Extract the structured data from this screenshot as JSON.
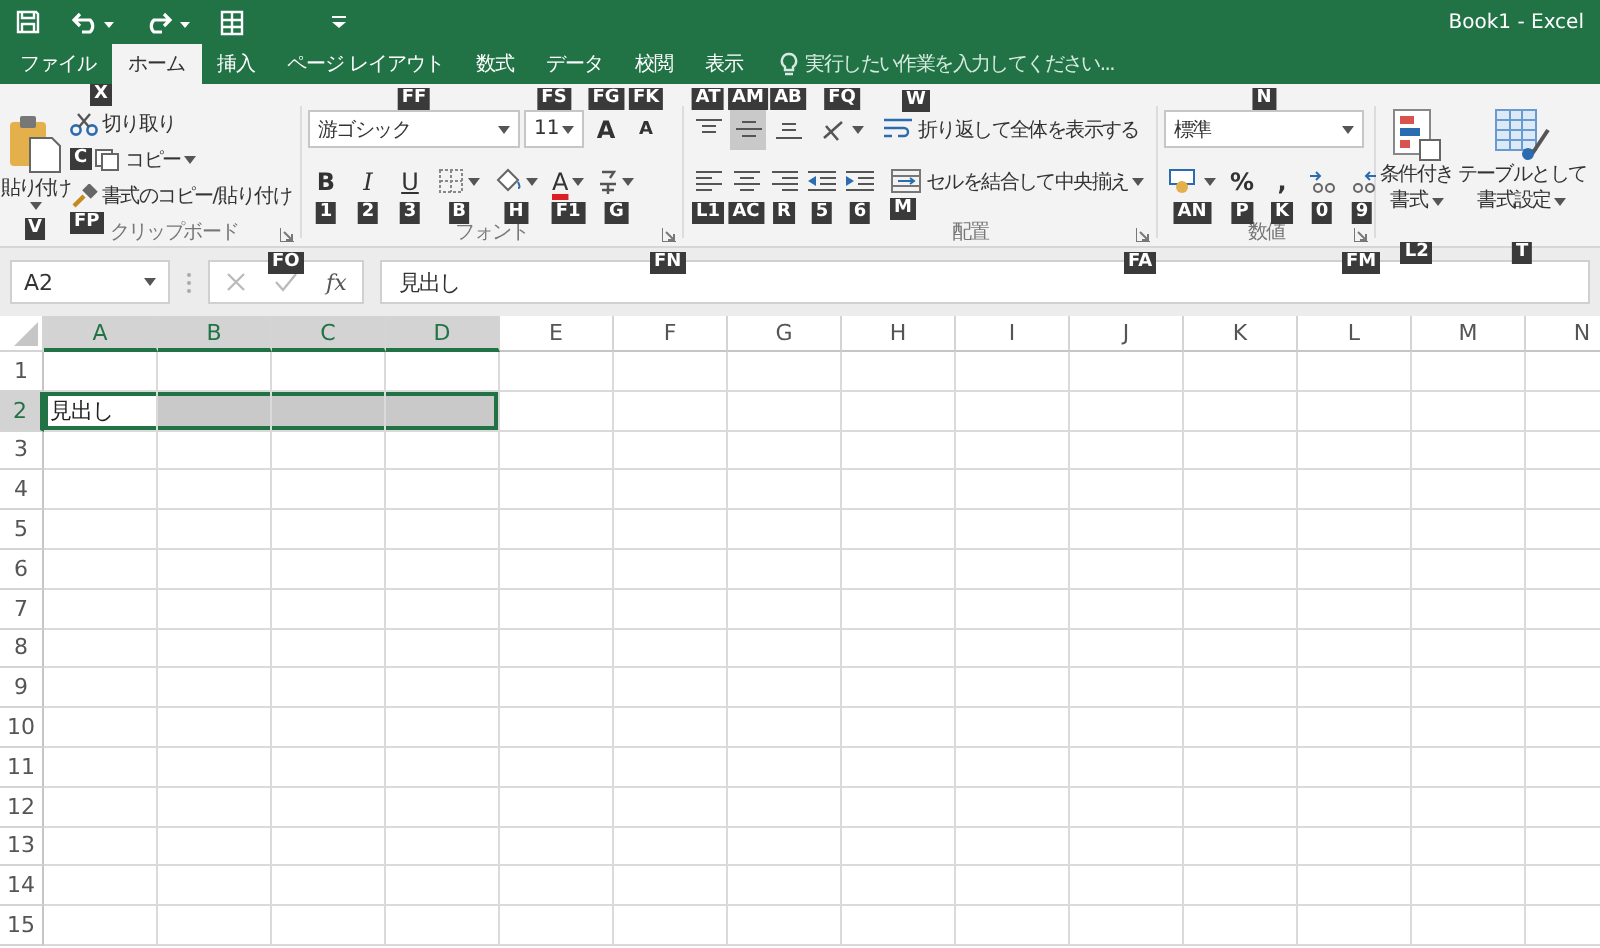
{
  "window": {
    "title": "Book1 - Excel"
  },
  "tabs": [
    {
      "label": "ファイル",
      "selected": false
    },
    {
      "label": "ホーム",
      "selected": true
    },
    {
      "label": "挿入",
      "selected": false
    },
    {
      "label": "ページ レイアウト",
      "selected": false
    },
    {
      "label": "数式",
      "selected": false
    },
    {
      "label": "データ",
      "selected": false
    },
    {
      "label": "校閲",
      "selected": false
    },
    {
      "label": "表示",
      "selected": false
    }
  ],
  "tell_me": {
    "placeholder": "実行したい作業を入力してください..."
  },
  "clipboard": {
    "label": "クリップボード",
    "launcher_keytip": "FO",
    "paste": {
      "label": "貼り付け",
      "keytip": "V"
    },
    "cut": {
      "label": "切り取り",
      "keytip": "X"
    },
    "copy": {
      "label": "コピー",
      "keytip": "C"
    },
    "painter": {
      "label": "書式のコピー/貼り付け",
      "keytip": "FP"
    }
  },
  "font": {
    "label": "フォント",
    "launcher_keytip": "FN",
    "name": {
      "value": "游ゴシック",
      "keytip": "FF"
    },
    "size": {
      "value": "11",
      "keytip": "FS"
    },
    "grow": {
      "text": "A",
      "keytip": "FG"
    },
    "shrink": {
      "text": "A",
      "keytip": "FK"
    },
    "buttons": [
      {
        "kind": "bold",
        "text": "B",
        "keytip": "1"
      },
      {
        "kind": "italic",
        "text": "I",
        "keytip": "2"
      },
      {
        "kind": "underline",
        "text": "U",
        "keytip": "3"
      },
      {
        "kind": "border",
        "keytip": "B"
      },
      {
        "kind": "fill",
        "keytip": "H"
      },
      {
        "kind": "color",
        "text": "A",
        "keytip": "F1"
      },
      {
        "kind": "phonetic",
        "keytip": "G"
      }
    ]
  },
  "alignment": {
    "label": "配置",
    "launcher_keytip": "FA",
    "top_row": [
      {
        "kind": "top",
        "keytip": "AT",
        "selected": false
      },
      {
        "kind": "middle",
        "keytip": "AM",
        "selected": true
      },
      {
        "kind": "bottom",
        "keytip": "AB",
        "selected": false
      },
      {
        "kind": "orientation",
        "keytip": "FQ",
        "selected": false
      }
    ],
    "wrap": {
      "label": "折り返して全体を表示する",
      "keytip": "W"
    },
    "bottom_row": [
      {
        "kind": "left",
        "keytip": "L1",
        "selected": false
      },
      {
        "kind": "center",
        "keytip": "AC",
        "selected": false
      },
      {
        "kind": "right",
        "keytip": "R",
        "selected": false
      },
      {
        "kind": "outdent",
        "keytip": "5",
        "selected": false
      },
      {
        "kind": "indent",
        "keytip": "6",
        "selected": false
      }
    ],
    "merge": {
      "label": "セルを結合して中央揃え",
      "keytip": "M"
    }
  },
  "number": {
    "label": "数値",
    "launcher_keytip": "FM",
    "format": {
      "value": "標準",
      "keytip": "N"
    },
    "buttons": [
      {
        "kind": "accounting",
        "keytip": "AN"
      },
      {
        "kind": "percent",
        "text": "%",
        "keytip": "P"
      },
      {
        "kind": "comma",
        "text": ",",
        "keytip": "K"
      },
      {
        "kind": "increase_decimal",
        "keytip": "0"
      },
      {
        "kind": "decrease_decimal",
        "keytip": "9"
      }
    ]
  },
  "styles": {
    "items": [
      {
        "kind": "conditional",
        "lines": [
          "条件付き",
          "書式"
        ],
        "keytip": "L2"
      },
      {
        "kind": "table",
        "lines": [
          "テーブルとして",
          "書式設定"
        ],
        "keytip": "T"
      }
    ]
  },
  "formula_bar": {
    "name_box": "A2",
    "function_label": "fx",
    "formula": "見出し"
  },
  "sheet": {
    "columns": [
      {
        "label": "A",
        "selected": true
      },
      {
        "label": "B",
        "selected": true
      },
      {
        "label": "C",
        "selected": true
      },
      {
        "label": "D",
        "selected": true
      },
      {
        "label": "E",
        "selected": false
      },
      {
        "label": "F",
        "selected": false
      },
      {
        "label": "G",
        "selected": false
      },
      {
        "label": "H",
        "selected": false
      },
      {
        "label": "I",
        "selected": false
      },
      {
        "label": "J",
        "selected": false
      },
      {
        "label": "K",
        "selected": false
      },
      {
        "label": "L",
        "selected": false
      },
      {
        "label": "M",
        "selected": false
      },
      {
        "label": "N",
        "selected": false
      }
    ],
    "rows": [
      {
        "label": "1",
        "selected": false
      },
      {
        "label": "2",
        "selected": true,
        "cells": [
          {
            "text": "見出し"
          }
        ]
      },
      {
        "label": "3",
        "selected": false
      },
      {
        "label": "4",
        "selected": false
      },
      {
        "label": "5",
        "selected": false
      },
      {
        "label": "6",
        "selected": false
      },
      {
        "label": "7",
        "selected": false
      },
      {
        "label": "8",
        "selected": false
      },
      {
        "label": "9",
        "selected": false
      },
      {
        "label": "10",
        "selected": false
      },
      {
        "label": "11",
        "selected": false
      },
      {
        "label": "12",
        "selected": false
      },
      {
        "label": "13",
        "selected": false
      },
      {
        "label": "14",
        "selected": false
      },
      {
        "label": "15",
        "selected": false
      }
    ]
  }
}
